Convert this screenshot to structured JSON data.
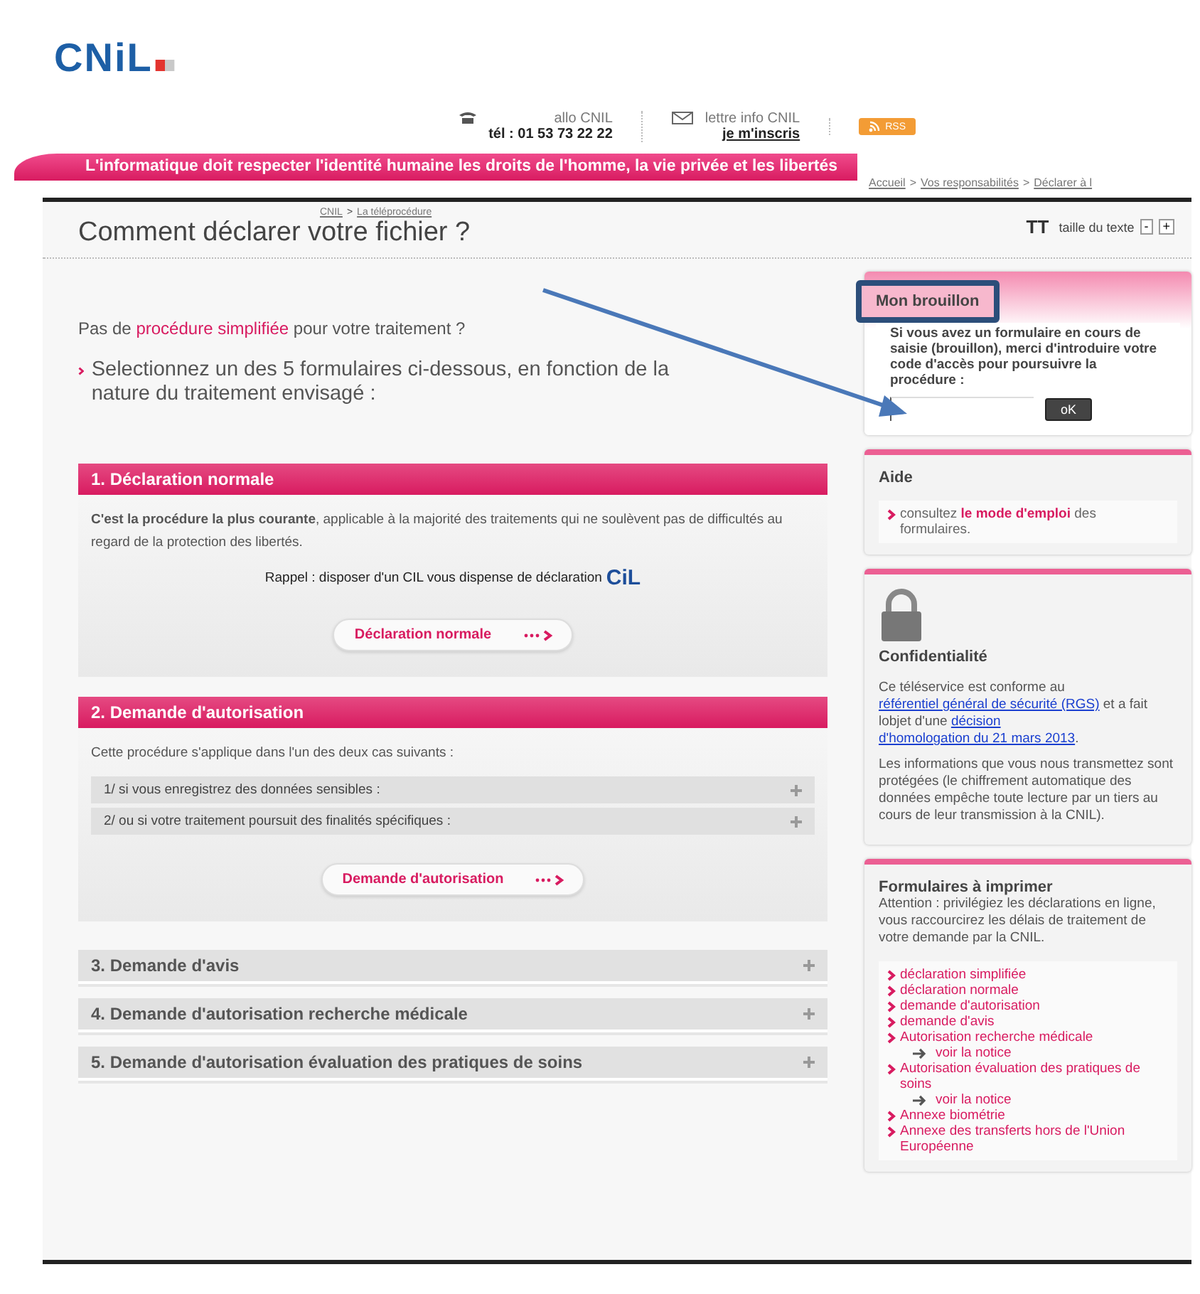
{
  "logo": {
    "text": "CNiL"
  },
  "contact": {
    "phone_label": "allo CNIL",
    "phone": "tél : 01 53 73 22 22",
    "newsletter_label": "lettre info CNIL",
    "newsletter_link": "je m'inscris",
    "rss": "RSS"
  },
  "banner": "L'informatique doit respecter l'identité humaine les droits de l'homme, la vie privée et les libertés",
  "breadcrumb_separator": ">",
  "top_breadcrumb": [
    "Accueil",
    "Vos responsabilités",
    "Déclarer à l"
  ],
  "breadcrumb": [
    "CNIL",
    "La téléprocédure"
  ],
  "page_title": "Comment déclarer votre fichier ?",
  "text_size": {
    "icon": "TT",
    "label": "taille du texte",
    "decrease": "-",
    "increase": "+"
  },
  "intro": {
    "before": "Pas de ",
    "link": "procédure simplifiée",
    "after": " pour votre traitement ?"
  },
  "instruction": "Selectionnez un des 5 formulaires ci-dessous, en fonction de la nature du traitement envisagé :",
  "sections": [
    {
      "title": "1. Déclaration normale",
      "expanded": true,
      "description": "**C'est la procédure la plus courante**, applicable à la majorité des traitements qui ne soulèvent pas de difficultés au regard de la protection des libertés.",
      "note": "Rappel : disposer d'un CIL vous dispense de déclaration",
      "note_logo": "CiL",
      "button": "Déclaration normale"
    },
    {
      "title": "2. Demande d'autorisation",
      "expanded": true,
      "description": "Cette procédure s'applique dans l'un des deux cas suivants :",
      "cases": [
        {
          "label": "1/  si vous enregistrez des données sensibles :",
          "expanded": false
        },
        {
          "label": "2/ ou si votre traitement poursuit des finalités spécifiques :",
          "expanded": false
        }
      ],
      "button": "Demande d'autorisation"
    },
    {
      "title": "3. Demande d'avis",
      "expanded": false
    },
    {
      "title": "4. Demande d'autorisation recherche médicale",
      "expanded": false
    },
    {
      "title": "5. Demande d'autorisation évaluation des pratiques de soins",
      "expanded": false
    }
  ],
  "draft": {
    "title": "Mon brouillon",
    "highlighted": true,
    "text": "Si vous avez un formulaire en cours de saisie (brouillon), merci d'introduire votre code d'accès pour poursuivre la procédure :",
    "button": "oK"
  },
  "help": {
    "title": "Aide",
    "before": "consultez ",
    "link": "le mode d'emploi",
    "after": " des formulaires."
  },
  "confidentiality": {
    "title": "Confidentialité",
    "paragraph_1": {
      "before": "Ce téléservice est conforme au ",
      "link_1": "référentiel général de sécurité (RGS)",
      "middle": " et a fait lobjet d'une ",
      "link_2": [
        "décision",
        "d'homologation du 21 mars 2013"
      ],
      "after": "."
    },
    "paragraph_2": "Les informations que vous nous transmettez sont protégées (le chiffrement automatique des données empêche toute lecture par un tiers au cours de leur transmission à la CNIL)."
  },
  "forms": {
    "title": "Formulaires à imprimer",
    "text": "Attention : privilégiez les déclarations en ligne, vous raccourcirez les délais de traitement de votre demande par la CNIL.",
    "links": [
      {
        "label": "déclaration simplifiée"
      },
      {
        "label": "déclaration normale"
      },
      {
        "label": "demande d'autorisation"
      },
      {
        "label": "demande d'avis"
      },
      {
        "label": "Autorisation recherche médicale",
        "children": [
          {
            "label": "voir la notice"
          }
        ]
      },
      {
        "label": "Autorisation évaluation des pratiques de soins",
        "children": [
          {
            "label": "voir la notice"
          }
        ]
      },
      {
        "label": "Annexe biométrie"
      },
      {
        "label": "Annexe des transferts hors de l'Union Européenne"
      }
    ]
  }
}
